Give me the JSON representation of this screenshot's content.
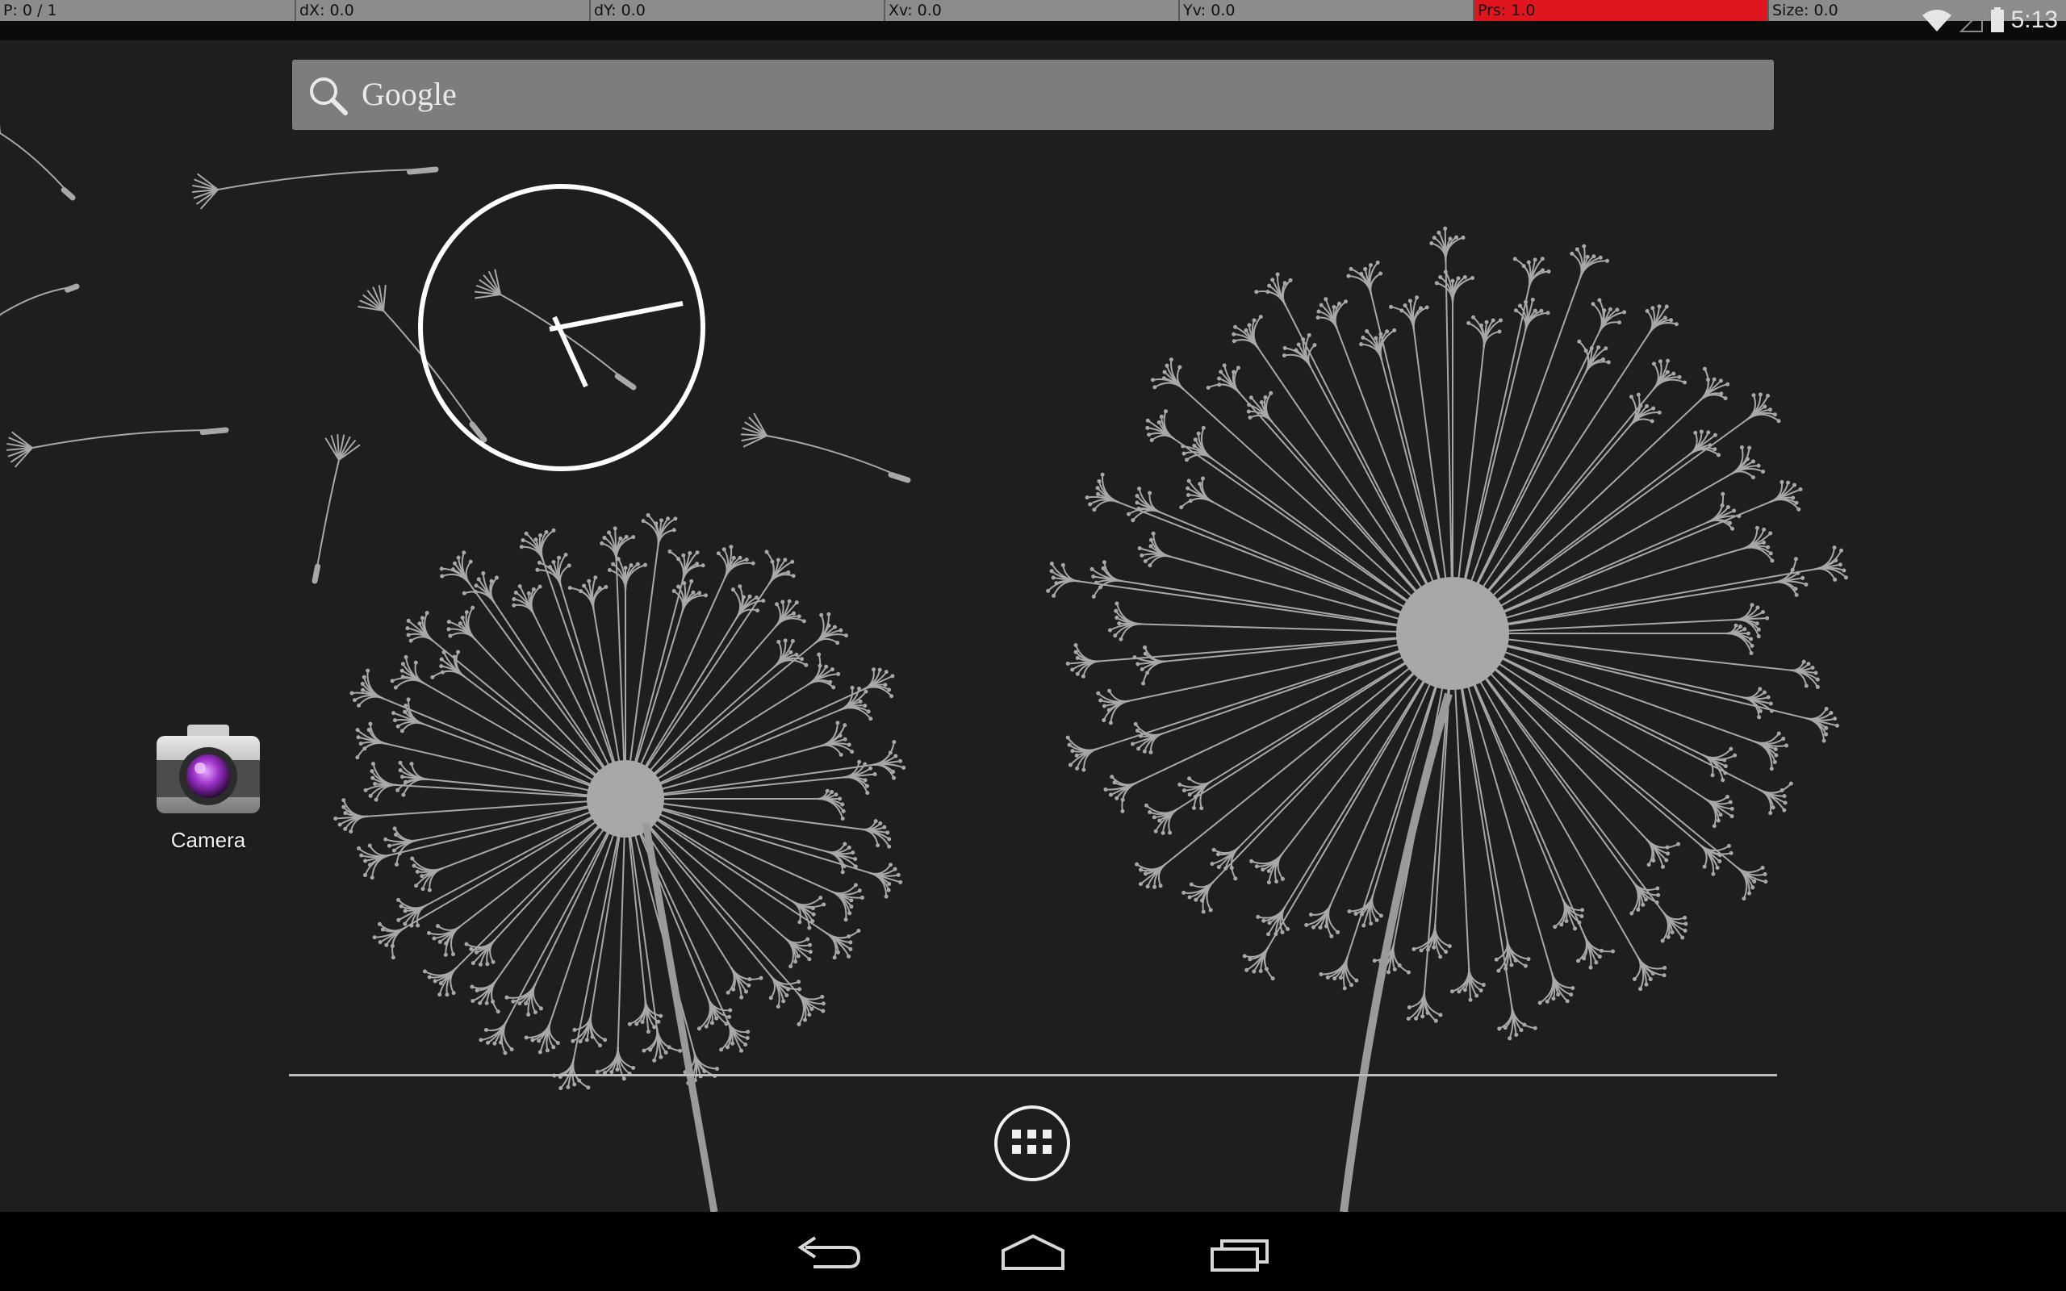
{
  "pointer_location": {
    "fields": [
      "P: 0 / 1",
      "dX: 0.0",
      "dY: 0.0",
      "Xv: 0.0",
      "Yv: 0.0",
      "Prs: 1.0",
      "Size: 0.0"
    ],
    "highlight_color": "#e0161e"
  },
  "status_bar": {
    "time": "5:13",
    "icons": [
      "wifi-icon",
      "signal-icon",
      "battery-icon"
    ]
  },
  "search": {
    "label": "Google",
    "icon": "search-icon"
  },
  "clock_widget": {
    "type": "analog-clock",
    "time": "5:13"
  },
  "shortcuts": [
    {
      "label": "Camera",
      "icon": "camera-icon"
    }
  ],
  "dock": {
    "all_apps_icon": "all-apps-icon"
  },
  "navigation": {
    "buttons": [
      "back-icon",
      "home-icon",
      "recent-apps-icon"
    ]
  },
  "colors": {
    "background": "#1e1e1e",
    "wallpaper_lines": "#a8a8a8",
    "search_bar": "#7d7d7d"
  },
  "wallpaper": "dandelions"
}
